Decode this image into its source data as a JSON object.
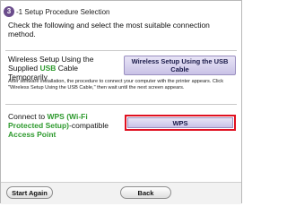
{
  "header": {
    "step_number": "3",
    "title": "-1 Setup Procedure Selection"
  },
  "instruction": "Check the following and select the most suitable connection method.",
  "usb_option": {
    "label_before": "Wireless Setup Using the Supplied ",
    "label_highlight": "USB",
    "label_after": " Cable Temporarily",
    "button_label": "Wireless Setup Using the USB Cable",
    "note": "After software installation, the procedure to connect your computer with the printer appears. Click \"Wireless Setup Using the USB Cable,\" then wait until the next screen appears."
  },
  "wps_option": {
    "label_before": "Connect to ",
    "label_highlight_1": "WPS (Wi-Fi Protected Setup)",
    "label_middle": "-compatible ",
    "label_highlight_2": "Access Point",
    "button_label": "WPS"
  },
  "footer": {
    "start_again_label": "Start Again",
    "back_label": "Back"
  },
  "colors": {
    "step_circle": "#6b4d8c",
    "highlight_green": "#2e9a2e",
    "wps_outline": "#e01020",
    "button_fill": "#c9c2e6"
  }
}
